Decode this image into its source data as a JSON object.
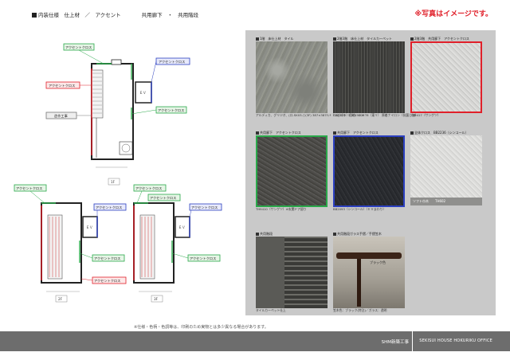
{
  "header": {
    "title": "内装仕様　仕上材　／　アクセント　　　　共用廊下　・　共用階段",
    "note": "※写真はイメージです。"
  },
  "floorplans": {
    "labels": {
      "accent_cross": "アクセントクロス",
      "construction": "造作工事",
      "ev": "ＥＶ"
    },
    "floors": [
      "1F",
      "2F",
      "3F"
    ]
  },
  "swatches": [
    {
      "caption": "1階　床仕上材　タイル",
      "sub": "アルディカ、グリジオ、(ロ-SK03-○(3F) 387×387ﾒｯﾄ（コピゴラ）目地：CUF",
      "color": "#8d8f89"
    },
    {
      "caption": "2階3階　床仕上材　タイルカーペット",
      "sub": "GA0403　500×500×T6（東リ） 原着ナイロン（抗菌し加）",
      "color": "#3a3a38"
    },
    {
      "caption": "2階3階　共用廊下　アクセントクロス",
      "sub": "TH9417（サンゲツ）",
      "color": "#d3d3d1"
    },
    {
      "caption": "共用廊下　アクセントクロス",
      "sub": "TH9410（サンゲツ）※玄関ドア廻り",
      "color": "#4f4e4b"
    },
    {
      "caption": "共用廊下　アクセントクロス",
      "sub": "BB2093（シンコール）（ＥＶまわり）",
      "color": "#2a2c30"
    },
    {
      "caption": "全体クロス　BB2236（シンコール）",
      "sub": "ソフト巾木　　TH602",
      "color": "#dcdcda"
    },
    {
      "caption": "共用階段",
      "sub": "タイルカーペット仕上",
      "color": "#7a7a76"
    },
    {
      "caption": "共用階段ガラス手摺／手摺笠木",
      "sub": "笠木色：ブラック(特注)／ガラス：透明",
      "callout": "ブラック色",
      "color": "#a8a49c"
    }
  ],
  "footer": {
    "note": "※仕様・色柄・色調等は、印刷のため実物とは多少異なる場合があります。",
    "project": "SHM新築工事",
    "company": "SEKISUI HOUSE HOKURIKU OFFICE"
  },
  "colors": {
    "accent_red": "#e0202a",
    "accent_green": "#2aa84a",
    "accent_blue": "#2b3fbf",
    "panel_bg": "#c9c9c9",
    "footer_bg": "#6d6d6d"
  }
}
